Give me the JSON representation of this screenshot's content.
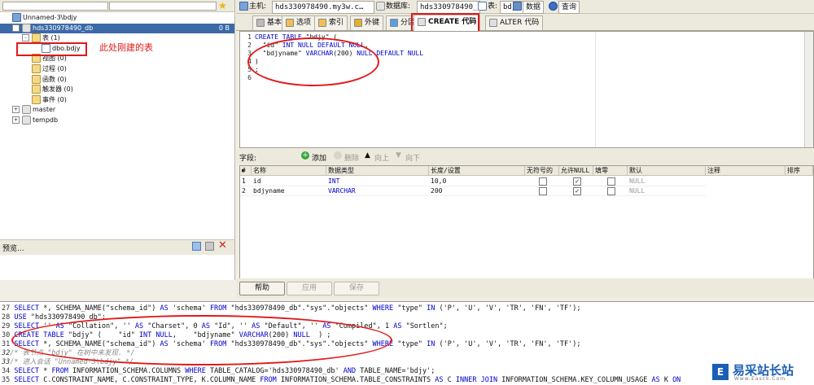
{
  "left_pane": {
    "tree": [
      {
        "label": "Unnamed-3\\bdjy",
        "indent": 0,
        "icon": "server-icon",
        "expander": ""
      },
      {
        "label": "hds330978490_db",
        "indent": 1,
        "icon": "database-icon",
        "expander": "-",
        "badge": "0 B",
        "selected": true
      },
      {
        "label": "表 (1)",
        "indent": 2,
        "icon": "folder-icon",
        "expander": "-"
      },
      {
        "label": "dbo.bdjy",
        "indent": 3,
        "icon": "table-icon",
        "expander": ""
      },
      {
        "label": "视图 (0)",
        "indent": 2,
        "icon": "folder-icon",
        "expander": ""
      },
      {
        "label": "过程 (0)",
        "indent": 2,
        "icon": "folder-icon",
        "expander": ""
      },
      {
        "label": "函数 (0)",
        "indent": 2,
        "icon": "folder-icon",
        "expander": ""
      },
      {
        "label": "触发器 (0)",
        "indent": 2,
        "icon": "folder-icon",
        "expander": ""
      },
      {
        "label": "事件 (0)",
        "indent": 2,
        "icon": "folder-icon",
        "expander": ""
      },
      {
        "label": "master",
        "indent": 1,
        "icon": "database-icon",
        "expander": "+"
      },
      {
        "label": "tempdb",
        "indent": 1,
        "icon": "database-icon",
        "expander": "+"
      }
    ],
    "annotation": "此处刚建的表",
    "preview_label": "预览..."
  },
  "topbar": {
    "host_label": "主机:",
    "host_value": "hds330978490.my3w.c…",
    "db_label": "数据库:",
    "db_value": "hds330978490_db",
    "table_label": "表:",
    "table_value": "bdjy",
    "data_label": "数据",
    "query_label": "查询"
  },
  "tabs": [
    {
      "label": "基本"
    },
    {
      "label": "选项"
    },
    {
      "label": "索引"
    },
    {
      "label": "外键"
    },
    {
      "label": "分区"
    },
    {
      "label": "CREATE 代码",
      "active": true
    },
    {
      "label": "ALTER 代码"
    }
  ],
  "editor": {
    "lines": [
      "1",
      "2",
      "3",
      "4",
      "5",
      "6"
    ],
    "code": [
      "CREATE TABLE \"bdjy\" (",
      "  \"id\" INT NULL DEFAULT NULL,",
      "  \"bdjyname\" VARCHAR(200) NULL DEFAULT NULL",
      ")",
      ";",
      ""
    ]
  },
  "fields": {
    "label": "字段:",
    "add": "添加",
    "delete": "删除",
    "up": "向上",
    "down": "向下",
    "headers": [
      "#",
      "名称",
      "数据类型",
      "长度/设置",
      "无符号的",
      "允许NULL",
      "填零",
      "默认",
      "注释",
      "排序"
    ],
    "rows": [
      {
        "num": "1",
        "name": "id",
        "type": "INT",
        "length": "10,0",
        "unsigned": false,
        "allow_null": true,
        "zerofill": false,
        "default": "NULL"
      },
      {
        "num": "2",
        "name": "bdjyname",
        "type": "VARCHAR",
        "length": "200",
        "unsigned": false,
        "allow_null": true,
        "zerofill": false,
        "default": "NULL"
      }
    ]
  },
  "buttons": {
    "help": "帮助",
    "apply": "应用",
    "save": "保存"
  },
  "log": [
    {
      "num": "27",
      "text": "SELECT *, SCHEMA_NAME(\"schema_id\") AS 'schema' FROM \"hds330978490_db\".\"sys\".\"objects\" WHERE \"type\" IN ('P', 'U', 'V', 'TR', 'FN', 'TF');",
      "comment": false
    },
    {
      "num": "28",
      "text": "USE \"hds330978490_db\";",
      "comment": false
    },
    {
      "num": "29",
      "text": "SELECT '' AS \"Collation\", '' AS \"Charset\", 0 AS \"Id\", '' AS \"Default\", '' AS \"Compiled\", 1 AS \"Sortlen\";",
      "comment": false
    },
    {
      "num": "30",
      "text": "CREATE TABLE \"bdjy\" (    \"id\" INT NULL,    \"bdjyname\" VARCHAR(200) NULL  ) ;",
      "comment": false
    },
    {
      "num": "31",
      "text": "SELECT *, SCHEMA_NAME(\"schema_id\") AS 'schema' FROM \"hds330978490_db\".\"sys\".\"objects\" WHERE \"type\" IN ('P', 'U', 'V', 'TR', 'FN', 'TF');",
      "comment": false
    },
    {
      "num": "32",
      "text": "/* 表节点 \"bdjy\" 在树中未发现. */",
      "comment": true
    },
    {
      "num": "33",
      "text": "/* 进入会话 \"Unnamed-3\\bdjy\" */",
      "comment": true
    },
    {
      "num": "34",
      "text": "SELECT * FROM INFORMATION_SCHEMA.COLUMNS WHERE TABLE_CATALOG='hds330978490_db' AND TABLE_NAME='bdjy';",
      "comment": false
    },
    {
      "num": "35",
      "text": "SELECT C.CONSTRAINT_NAME, C.CONSTRAINT_TYPE, K.COLUMN_NAME FROM INFORMATION_SCHEMA.TABLE_CONSTRAINTS AS C INNER JOIN INFORMATION_SCHEMA.KEY_COLUMN_USAGE AS K ON",
      "comment": false
    }
  ],
  "watermark": {
    "title": "易采站长站",
    "sub": "Www.Easck.Com"
  },
  "colors": {
    "annotation": "#e01919",
    "keyword": "#0000cc",
    "selected": "#3c6aa8"
  }
}
